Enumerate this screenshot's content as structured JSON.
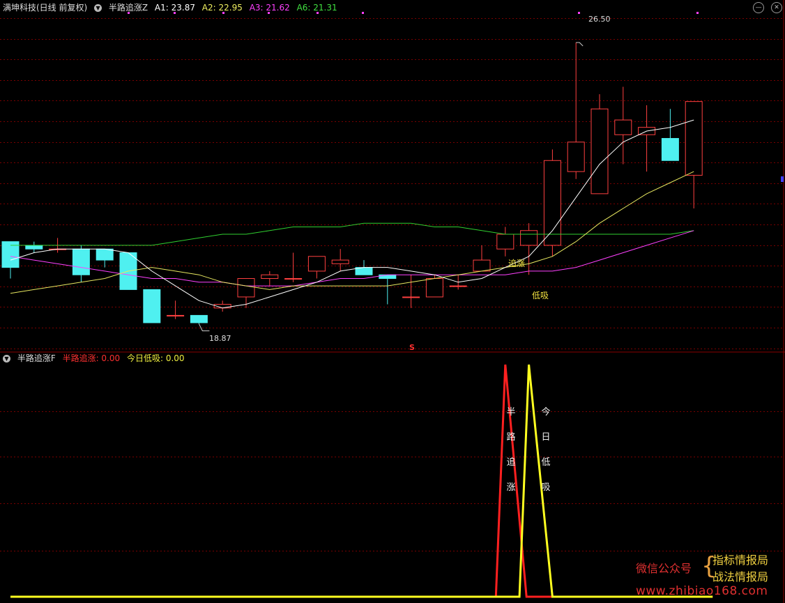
{
  "header": {
    "stock": "满坤科技(日线 前复权)",
    "indicator": "半路追涨Z",
    "a1": "A1: 23.87",
    "a2": "A2: 22.95",
    "a3": "A3: 21.62",
    "a6": "A6: 21.31"
  },
  "sub_header": {
    "indicator": "半路追涨F",
    "v1": "半路追涨: 0.00",
    "v2": "今日低吸: 0.00"
  },
  "labels": {
    "high": "26.50",
    "low": "18.87",
    "zhuizhang": "追涨",
    "dixi": "低吸",
    "s_mark": "S",
    "vert1": "半路追涨",
    "vert2": "今日低吸"
  },
  "watermark": {
    "wechat": "微信公众号",
    "brace": "{",
    "line1": "指标情报局",
    "line2": "战法情报局",
    "site": "www.zhibiao168.com"
  },
  "colors": {
    "up": "#ff4040",
    "down": "#4ff0f0",
    "ma_short": "#ffffff",
    "ma_mid": "#e8e860",
    "ma_long": "#ff40ff",
    "ma_green": "#30d030",
    "grid": "#7a0000",
    "sig_red": "#ff2020",
    "sig_yellow": "#ffff20"
  },
  "chart_data": [
    {
      "type": "candlestick",
      "price_range": [
        18.2,
        27.2
      ],
      "candles": [
        {
          "o": 21.1,
          "h": 21.1,
          "l": 20.1,
          "c": 20.4
        },
        {
          "o": 21.0,
          "h": 21.1,
          "l": 20.8,
          "c": 20.9
        },
        {
          "o": 20.9,
          "h": 21.2,
          "l": 20.8,
          "c": 20.9
        },
        {
          "o": 20.9,
          "h": 21.0,
          "l": 20.0,
          "c": 20.2
        },
        {
          "o": 20.9,
          "h": 20.9,
          "l": 20.4,
          "c": 20.6
        },
        {
          "o": 20.8,
          "h": 20.8,
          "l": 19.9,
          "c": 19.8
        },
        {
          "o": 19.8,
          "h": 19.8,
          "l": 18.9,
          "c": 18.9
        },
        {
          "o": 19.1,
          "h": 19.5,
          "l": 19.0,
          "c": 19.1
        },
        {
          "o": 19.1,
          "h": 19.1,
          "l": 18.87,
          "c": 18.9
        },
        {
          "o": 19.3,
          "h": 19.5,
          "l": 19.2,
          "c": 19.4
        },
        {
          "o": 19.6,
          "h": 20.1,
          "l": 19.3,
          "c": 20.1
        },
        {
          "o": 20.1,
          "h": 20.3,
          "l": 19.9,
          "c": 20.2
        },
        {
          "o": 20.1,
          "h": 20.8,
          "l": 20.0,
          "c": 20.1
        },
        {
          "o": 20.3,
          "h": 20.7,
          "l": 20.1,
          "c": 20.7
        },
        {
          "o": 20.5,
          "h": 20.9,
          "l": 20.3,
          "c": 20.6
        },
        {
          "o": 20.4,
          "h": 20.6,
          "l": 20.2,
          "c": 20.2
        },
        {
          "o": 20.2,
          "h": 20.2,
          "l": 19.4,
          "c": 20.1
        },
        {
          "o": 19.6,
          "h": 20.2,
          "l": 19.3,
          "c": 19.6
        },
        {
          "o": 19.6,
          "h": 20.2,
          "l": 19.6,
          "c": 20.1
        },
        {
          "o": 19.9,
          "h": 20.2,
          "l": 19.8,
          "c": 19.9
        },
        {
          "o": 20.3,
          "h": 21.0,
          "l": 20.3,
          "c": 20.6
        },
        {
          "o": 20.9,
          "h": 21.5,
          "l": 20.7,
          "c": 21.3
        },
        {
          "o": 21.0,
          "h": 21.6,
          "l": 20.2,
          "c": 21.4
        },
        {
          "o": 21.0,
          "h": 23.6,
          "l": 20.7,
          "c": 23.3
        },
        {
          "o": 23.0,
          "h": 26.5,
          "l": 22.8,
          "c": 23.8
        },
        {
          "o": 22.4,
          "h": 25.1,
          "l": 22.4,
          "c": 24.7
        },
        {
          "o": 24.0,
          "h": 25.3,
          "l": 23.2,
          "c": 24.4
        },
        {
          "o": 24.0,
          "h": 24.8,
          "l": 23.0,
          "c": 24.2
        },
        {
          "o": 23.9,
          "h": 24.7,
          "l": 23.3,
          "c": 23.3
        },
        {
          "o": 22.9,
          "h": 24.9,
          "l": 22.0,
          "c": 24.9
        }
      ],
      "ma_short": [
        20.6,
        20.8,
        20.9,
        20.9,
        20.9,
        20.8,
        20.3,
        19.9,
        19.5,
        19.3,
        19.4,
        19.6,
        19.8,
        20.0,
        20.3,
        20.4,
        20.4,
        20.3,
        20.2,
        20.0,
        20.1,
        20.4,
        20.7,
        21.4,
        22.3,
        23.2,
        23.8,
        24.1,
        24.2,
        24.4
      ],
      "ma_mid": [
        19.7,
        19.8,
        19.9,
        20.0,
        20.1,
        20.3,
        20.4,
        20.3,
        20.2,
        20.0,
        19.9,
        19.8,
        19.9,
        19.9,
        19.9,
        19.9,
        19.9,
        20.0,
        20.1,
        20.2,
        20.3,
        20.4,
        20.5,
        20.7,
        21.1,
        21.6,
        22.0,
        22.4,
        22.7,
        23.0
      ],
      "ma_long": [
        20.7,
        20.6,
        20.5,
        20.4,
        20.3,
        20.2,
        20.1,
        20.1,
        20.0,
        20.0,
        19.9,
        19.9,
        19.9,
        20.0,
        20.1,
        20.1,
        20.2,
        20.2,
        20.2,
        20.2,
        20.2,
        20.2,
        20.3,
        20.3,
        20.4,
        20.6,
        20.8,
        21.0,
        21.2,
        21.4
      ],
      "ma_green": [
        21.0,
        21.0,
        21.0,
        21.0,
        21.0,
        21.0,
        21.0,
        21.1,
        21.2,
        21.3,
        21.3,
        21.4,
        21.5,
        21.5,
        21.5,
        21.6,
        21.6,
        21.6,
        21.5,
        21.5,
        21.4,
        21.3,
        21.3,
        21.3,
        21.3,
        21.3,
        21.3,
        21.3,
        21.3,
        21.4
      ]
    },
    {
      "type": "line",
      "y_range": [
        0,
        1
      ],
      "series": [
        {
          "name": "半路追涨",
          "points": [
            [
              0,
              0
            ],
            [
              20.6,
              0
            ],
            [
              21.0,
              1
            ],
            [
              21.9,
              0
            ],
            [
              29.8,
              0
            ]
          ]
        },
        {
          "name": "今日低吸",
          "points": [
            [
              0,
              0
            ],
            [
              21.6,
              0
            ],
            [
              22.0,
              1
            ],
            [
              23.0,
              0
            ],
            [
              29.8,
              0
            ]
          ]
        }
      ]
    }
  ]
}
